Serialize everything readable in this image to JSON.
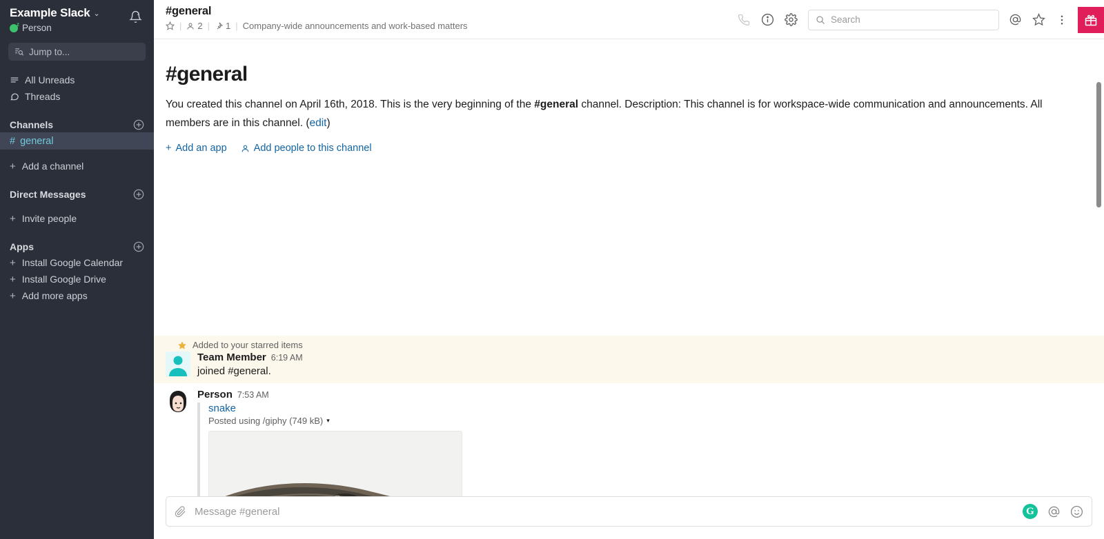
{
  "sidebar": {
    "workspace_name": "Example Slack",
    "workspace_caret": "⌄",
    "user_name": "Person",
    "notifications_icon": "bell-snooze-icon",
    "jump_to": "Jump to...",
    "nav": [
      {
        "label": "All Unreads",
        "icon": "unreads-icon"
      },
      {
        "label": "Threads",
        "icon": "threads-icon"
      }
    ],
    "channels_section": {
      "title": "Channels",
      "add_icon": "plus-circle-icon"
    },
    "channels": [
      {
        "hash": "#",
        "name": "general",
        "active": true
      }
    ],
    "add_channel": {
      "plus": "+",
      "label": "Add a channel"
    },
    "dm_section": {
      "title": "Direct Messages",
      "add_icon": "plus-circle-icon"
    },
    "invite_people": {
      "plus": "+",
      "label": "Invite people"
    },
    "apps_section": {
      "title": "Apps",
      "add_icon": "plus-circle-icon"
    },
    "apps": [
      {
        "plus": "+",
        "label": "Install Google Calendar"
      },
      {
        "plus": "+",
        "label": "Install Google Drive"
      },
      {
        "plus": "+",
        "label": "Add more apps"
      }
    ]
  },
  "header": {
    "channel_name": "#general",
    "star_icon": "star-outline-icon",
    "members_count": "2",
    "members_icon": "person-icon",
    "pins_count": "1",
    "pins_icon": "pin-icon",
    "topic": "Company-wide announcements and work-based matters",
    "sep": "|",
    "call_icon": "phone-icon",
    "info_icon": "info-circle-icon",
    "settings_icon": "gear-icon",
    "search_placeholder": "Search",
    "search_icon": "search-icon",
    "mentions_icon": "at-mention-icon",
    "starred_icon": "star-outline-icon",
    "more_icon": "kebab-menu-icon",
    "gift_icon": "gift-icon",
    "gift_color": "#e01e5a"
  },
  "intro": {
    "title": "#general",
    "text_1": "You created this channel on April 16th, 2018. This is the very beginning of the ",
    "channel_bold": "#general",
    "text_2": " channel. Description: This channel is for workspace-wide communication and announcements. All members are in this channel. (",
    "edit_link": "edit",
    "text_3": ")",
    "add_app": {
      "plus": "+",
      "label": "Add an app"
    },
    "add_people": {
      "icon": "person-add-icon",
      "label": "Add people to this channel"
    }
  },
  "messages": [
    {
      "starred_label": "Added to your starred items",
      "starred_icon": "star-filled-icon",
      "author": "Team Member",
      "time": "6:19 AM",
      "text": "joined #general.",
      "avatar": "default-person-avatar",
      "starred": true
    },
    {
      "author": "Person",
      "time": "7:53 AM",
      "attachment_title": "snake",
      "attachment_sub": "Posted using /giphy (749 kB)",
      "attachment_caret": "▾",
      "avatar": "illustrated-face-avatar",
      "starred": false
    }
  ],
  "composer": {
    "attach_icon": "paperclip-icon",
    "placeholder": "Message #general",
    "grammarly_icon": "G",
    "mention_icon": "at-mention-icon",
    "emoji_icon": "emoji-smiley-icon"
  }
}
